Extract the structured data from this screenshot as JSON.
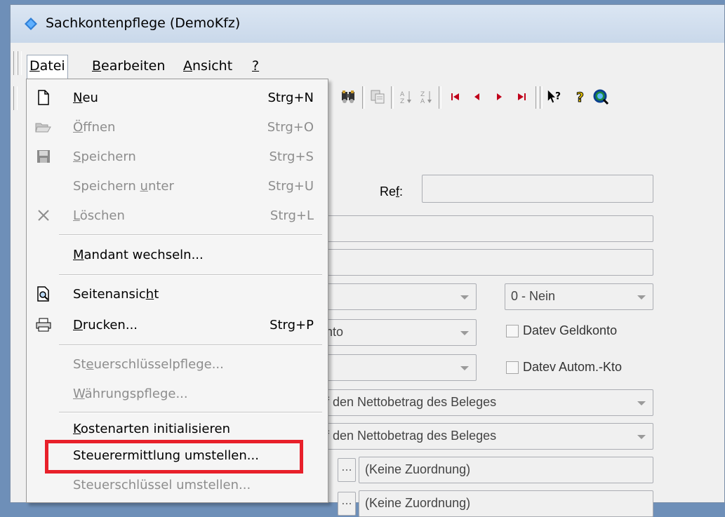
{
  "window": {
    "title": "Sachkontenpflege (DemoKfz)"
  },
  "menubar": {
    "datei": {
      "pre": "",
      "u": "D",
      "post": "atei"
    },
    "bearbeiten": {
      "pre": "",
      "u": "B",
      "post": "earbeiten"
    },
    "ansicht": {
      "pre": "",
      "u": "A",
      "post": "nsicht"
    },
    "help": {
      "pre": "",
      "u": "?",
      "post": ""
    }
  },
  "toolbar": {
    "icons": [
      "find-icon",
      "copy-icon",
      "sort-asc-icon",
      "sort-desc-icon",
      "first-record-icon",
      "prev-record-icon",
      "next-record-icon",
      "last-record-icon",
      "context-help-icon",
      "help-icon",
      "globe-search-icon"
    ]
  },
  "form": {
    "ref_label_pre": "Re",
    "ref_label_u": "f",
    "ref_label_post": ":",
    "combo_right_value": "0 - Nein",
    "combo_konto_value": "nto",
    "datev_geldkonto": "Datev Geldkonto",
    "datev_autom": "Datev Autom.-Kto",
    "netto1": "f den Nettobetrag des Beleges",
    "netto2": "f den Nettobetrag des Beleges",
    "dots": "...",
    "zuordnung1": "(Keine Zuordnung)",
    "zuordnung2": "(Keine Zuordnung)"
  },
  "menu": {
    "items": [
      {
        "pre": "",
        "u": "N",
        "post": "eu",
        "shortcut": "Strg+N"
      },
      {
        "pre": "",
        "u": "Ö",
        "post": "ffnen",
        "shortcut": "Strg+O"
      },
      {
        "pre": "",
        "u": "S",
        "post": "peichern",
        "shortcut": "Strg+S"
      },
      {
        "pre": "Speichern ",
        "u": "u",
        "post": "nter",
        "shortcut": "Strg+U"
      },
      {
        "pre": "",
        "u": "L",
        "post": "öschen",
        "shortcut": "Strg+L"
      },
      {
        "pre": "",
        "u": "M",
        "post": "andant wechseln...",
        "shortcut": ""
      },
      {
        "pre": "Seitenansic",
        "u": "h",
        "post": "t",
        "shortcut": ""
      },
      {
        "pre": "",
        "u": "D",
        "post": "rucken...",
        "shortcut": "Strg+P"
      },
      {
        "pre": "St",
        "u": "e",
        "post": "uerschlüsselpflege...",
        "shortcut": ""
      },
      {
        "pre": "",
        "u": "W",
        "post": "ährungspflege...",
        "shortcut": ""
      },
      {
        "pre": "",
        "u": "K",
        "post": "ostenarten initialisieren",
        "shortcut": ""
      },
      {
        "pre": "Steuerermittlung umstellen...",
        "u": "",
        "post": "",
        "shortcut": ""
      },
      {
        "pre": "Steuerschlüssel umstellen...",
        "u": "",
        "post": "",
        "shortcut": ""
      }
    ]
  },
  "colors": {
    "highlight": "#e8202a",
    "disabled_text": "#8d8d8d"
  }
}
